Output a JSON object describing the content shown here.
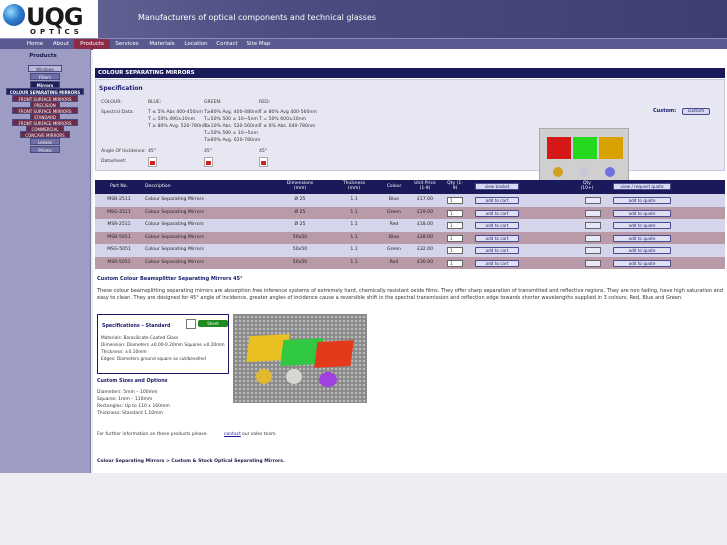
{
  "header": {
    "brand": "UQG",
    "brand_sub": "OPTICS",
    "tagline": "Manufacturers of optical components and technical glasses"
  },
  "nav": {
    "items": [
      "Home",
      "About",
      "Products",
      "Services",
      "Materials",
      "Location",
      "Contact",
      "Site Map"
    ],
    "active": "Products"
  },
  "sidebar": {
    "title": "Products",
    "items": [
      {
        "label": "Windows"
      },
      {
        "label": "Filters"
      },
      {
        "label": "Mirrors"
      },
      {
        "label": "COLOUR SEPARATING MIRRORS"
      },
      {
        "label": "FRONT SURFACE MIRRORS"
      },
      {
        "label": "PRECISION"
      },
      {
        "label": "FRONT SURFACE MIRRORS"
      },
      {
        "label": "STANDARD"
      },
      {
        "label": "FRONT SURFACE MIRRORS"
      },
      {
        "label": "COMMERCIAL"
      },
      {
        "label": "CONCAVE MIRRORS"
      },
      {
        "label": "Lenses"
      },
      {
        "label": "Prisms"
      }
    ]
  },
  "category": {
    "heading": "COLOUR SEPARATING MIRRORS"
  },
  "spec": {
    "title": "Specification",
    "colour_label": "COLOUR:",
    "spectral_label": "Spectral Data:",
    "angle_label": "Angle Of Incidence:",
    "datasheet_label": "Datasheet:",
    "columns": [
      {
        "name": "BLUE:",
        "lines": [
          "T ≤ 5% Abs 400-450nm",
          "T = 50% 490±10nm",
          "T ≥ 80% Avg. 520-780nm"
        ],
        "angle": "45°"
      },
      {
        "name": "GREEN:",
        "lines": [
          "T≥80% Avg. 400-480nm",
          "T=50% 500 ± 10~5nm",
          "T≥10% Abs. 520-560nm",
          "T=50% 590 ± 10~5nm",
          "T≥80% Avg. 620-780nm"
        ],
        "angle": "45°"
      },
      {
        "name": "RED:",
        "lines": [
          "T ≥ 80% Avg 400-560nm",
          "T = 50% 600±10nm",
          "T ≤ 6% Abs. 640-780nm"
        ],
        "angle": "45°"
      }
    ],
    "custom_label": "Custom:",
    "custom_button": "custom",
    "swatch_colors": {
      "red": "#d61818",
      "green": "#25d820",
      "orange": "#d8a000",
      "dot1": "#d4a020",
      "dot2": "#c8c8d8",
      "dot3": "#7070e0"
    }
  },
  "table": {
    "headers": {
      "part": "Part No.",
      "desc": "Description",
      "dims": "Dimensions (mm)",
      "thick": "Thickness (mm)",
      "colour": "Colour",
      "price": "Unit Price (1-9)",
      "qty1": "Qty (1-9)",
      "basket": "view basket",
      "qty2": "Qty (10+)",
      "quote": "view / request quote"
    },
    "rows": [
      {
        "part": "MSB-2511",
        "desc": "Colour Separating Mirrors",
        "dims": "Ø 25",
        "thick": "1.1",
        "colour": "Blue",
        "price": "£17.00",
        "qty": "1",
        "cart": "add to cart",
        "quote": "add to quote"
      },
      {
        "part": "MSG-2511",
        "desc": "Colour Separating Mirrors",
        "dims": "Ø 25",
        "thick": "1.1",
        "colour": "Green",
        "price": "£19.00",
        "qty": "1",
        "cart": "add to cart",
        "quote": "add to quote"
      },
      {
        "part": "MSR-2511",
        "desc": "Colour Separating Mirrors",
        "dims": "Ø 25",
        "thick": "1.1",
        "colour": "Red",
        "price": "£18.00",
        "qty": "1",
        "cart": "add to cart",
        "quote": "add to quote"
      },
      {
        "part": "MSB-5051",
        "desc": "Colour Separating Mirrors",
        "dims": "50x50",
        "thick": "1.1",
        "colour": "Blue",
        "price": "£28.00",
        "qty": "1",
        "cart": "add to cart",
        "quote": "add to quote"
      },
      {
        "part": "MSG-5051",
        "desc": "Colour Separating Mirrors",
        "dims": "50x50",
        "thick": "1.1",
        "colour": "Green",
        "price": "£32.00",
        "qty": "1",
        "cart": "add to cart",
        "quote": "add to quote"
      },
      {
        "part": "MSR-5051",
        "desc": "Colour Separating Mirrors",
        "dims": "50x50",
        "thick": "1.1",
        "colour": "Red",
        "price": "£30.00",
        "qty": "1",
        "cart": "add to cart",
        "quote": "add to quote"
      }
    ]
  },
  "description": {
    "title": "Custom Colour Beamsplitter Separating Mirrors 45°",
    "body": "These colour beamsplitting separating mirrors are absorption free inference systems of extremely hard, chemically resistant oxide films. They offer sharp separation of transmitted and reflective regions. They are non fading, have high saturation and easy to clean. They are designed for 45° angle of incidence, greater angles of incidence cause a reversible shift in the spectral transmission and reflection edge towards shorter wavelengths supplied in 3 colours, Red, Blue and Green."
  },
  "standard": {
    "title": "Specifications – Standard",
    "sheet_button": "Sheet",
    "lines": [
      "Materials: Borosilicate Coated Glass",
      "Dimension: Diameters ±0.00-0.20mm Squares ±0.20mm",
      "Thickness: ±0.10mm",
      "Edges: Diameters ground square as cut/bevelled"
    ]
  },
  "sizes": {
    "title": "Custom Sizes and Options",
    "lines": [
      "Diameters: 5mm – 100mm",
      "Squares: 1mm – 110mm",
      "Rectangles: Up to 110 x 160mm",
      "Thickness: Standard 1.10mm"
    ]
  },
  "contact": {
    "text_before": "For further information on these products please",
    "link": "contact",
    "text_after": "our sales team."
  },
  "breadcrumb": "Colour Separating Mirrors > Custom & Stock Optical Separating Mirrors."
}
